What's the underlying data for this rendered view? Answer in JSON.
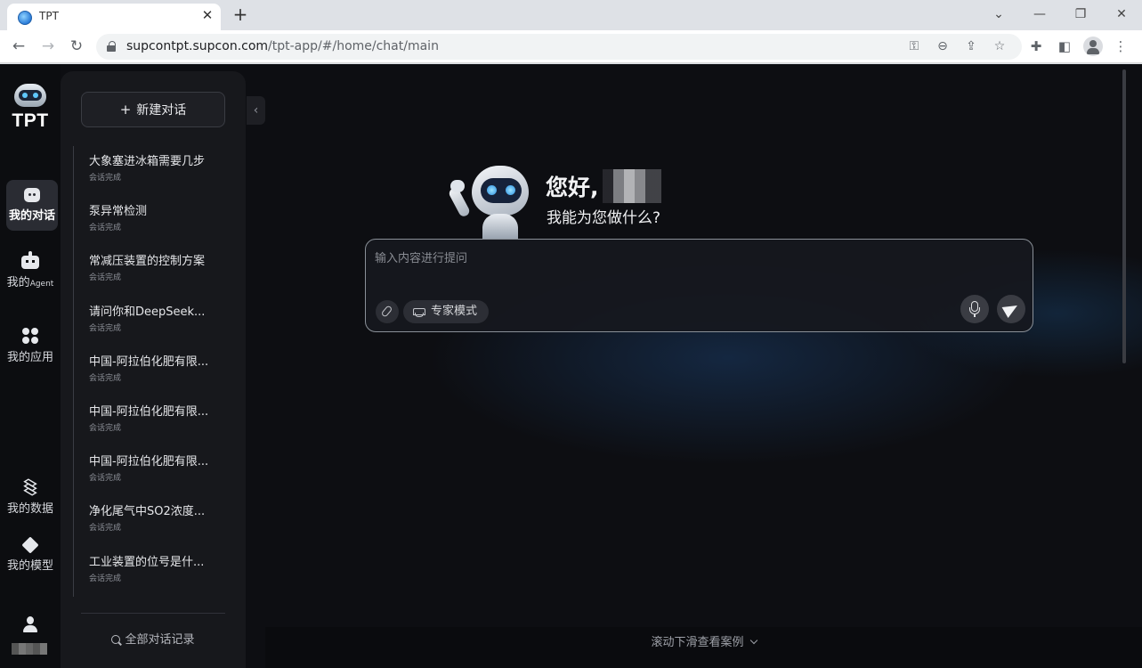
{
  "browser": {
    "tab_title": "TPT",
    "url_domain": "supcontpt.supcon.com",
    "url_path": "/tpt-app/#/home/chat/main",
    "new_tab": "+",
    "close_tab": "✕"
  },
  "app": {
    "logo_text": "TPT",
    "rail": {
      "chat_label": "我的对话",
      "agent_label_prefix": "我的",
      "agent_label_suffix": "Agent",
      "apps_label": "我的应用",
      "data_label": "我的数据",
      "model_label": "我的模型"
    },
    "history": {
      "new_chat_label": "新建对话",
      "items": [
        {
          "title": "大象塞进冰箱需要几步",
          "status": "会话完成"
        },
        {
          "title": "泵异常检测",
          "status": "会话完成"
        },
        {
          "title": "常减压装置的控制方案",
          "status": "会话完成"
        },
        {
          "title": "请问你和DeepSeek...",
          "status": "会话完成"
        },
        {
          "title": "中国-阿拉伯化肥有限...",
          "status": "会话完成"
        },
        {
          "title": "中国-阿拉伯化肥有限...",
          "status": "会话完成"
        },
        {
          "title": "中国-阿拉伯化肥有限...",
          "status": "会话完成"
        },
        {
          "title": "净化尾气中SO2浓度...",
          "status": "会话完成"
        },
        {
          "title": "工业装置的位号是什...",
          "status": "会话完成"
        }
      ],
      "all_history_label": "全部对话记录"
    },
    "main": {
      "greeting": "您好,",
      "greeting_sub": "我能为您做什么?",
      "input_placeholder": "输入内容进行提问",
      "expert_mode_label": "专家模式",
      "scroll_hint": "滚动下滑查看案例"
    }
  }
}
